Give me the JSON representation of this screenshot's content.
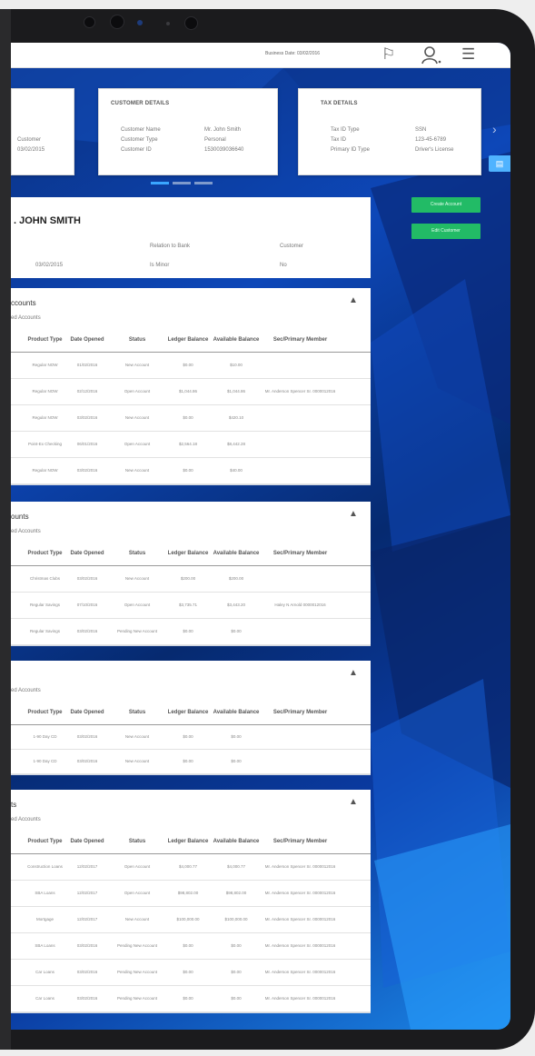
{
  "topbar": {
    "business_date": "Business Date: 03/02/2016",
    "icons": [
      "flag-icon",
      "user-icon",
      "menu-icon"
    ]
  },
  "cards": {
    "partial": {
      "rows": [
        {
          "value": "Customer"
        },
        {
          "value": "03/02/2015"
        }
      ]
    },
    "customer": {
      "title": "CUSTOMER DETAILS",
      "rows": [
        {
          "label": "Customer Name",
          "value": "Mr. John Smith"
        },
        {
          "label": "Customer Type",
          "value": "Personal"
        },
        {
          "label": "Customer ID",
          "value": "1530039036640"
        }
      ]
    },
    "tax": {
      "title": "TAX DETAILS",
      "rows": [
        {
          "label": "Tax ID Type",
          "value": "SSN"
        },
        {
          "label": "Tax ID",
          "value": "123-45-6789"
        },
        {
          "label": "Primary ID Type",
          "value": "Driver's License"
        }
      ]
    }
  },
  "actions": {
    "create_account": "Create Account",
    "edit_customer": "Edit Customer"
  },
  "customer": {
    "name": ". JOHN SMITH",
    "relation_label": "Relation to Bank",
    "relation_value": "Customer",
    "since": "03/02/2015",
    "minor_label": "Is Minor",
    "minor_value": "No"
  },
  "columns": [
    "Product Type",
    "Date Opened",
    "Status",
    "Ledger Balance",
    "Available Balance",
    "Sec/Primary Member"
  ],
  "sections": [
    {
      "title": "ccounts",
      "subtitle": "ed Accounts",
      "rows": [
        [
          "Regular NOW",
          "01/02/2016",
          "New Account",
          "$0.00",
          "$10.00",
          ""
        ],
        [
          "Regular NOW",
          "02/12/2016",
          "Open Account",
          "$1,044.86",
          "$1,044.86",
          "Mr. Anderson Spencer Sr. 0000012016"
        ],
        [
          "Regular NOW",
          "03/02/2016",
          "New Account",
          "$0.00",
          "$420.10",
          ""
        ],
        [
          "Point-Ex Checking",
          "06/01/2016",
          "Open Account",
          "$2,564.18",
          "$8,442.28",
          ""
        ],
        [
          "Regular NOW",
          "03/02/2016",
          "New Account",
          "$0.00",
          "$40.00",
          ""
        ]
      ]
    },
    {
      "title": "ounts",
      "subtitle": "ed Accounts",
      "rows": [
        [
          "Christmas Clubs",
          "03/02/2016",
          "New Account",
          "$200.00",
          "$200.00",
          ""
        ],
        [
          "Regular Savings",
          "07/10/2016",
          "Open Account",
          "$3,735.71",
          "$3,443.20",
          "Haley N Arnold 0000012016"
        ],
        [
          "Regular Savings",
          "03/02/2016",
          "Pending New Account",
          "$0.00",
          "$0.00",
          ""
        ]
      ]
    },
    {
      "title": "",
      "subtitle": "ed Accounts",
      "rows": [
        [
          "1-90 Day CD",
          "03/02/2016",
          "New Account",
          "$0.00",
          "$0.00",
          ""
        ],
        [
          "1-90 Day CD",
          "03/02/2016",
          "New Account",
          "$0.00",
          "$0.00",
          ""
        ]
      ]
    },
    {
      "title": "ts",
      "subtitle": "ed Accounts",
      "rows": [
        [
          "Construction Loans",
          "12/02/2017",
          "Open Account",
          "$4,000.77",
          "$4,000.77",
          "Mr. Anderson Spencer Sr. 0000012016"
        ],
        [
          "SBA Loans",
          "12/02/2017",
          "Open Account",
          "$98,802.00",
          "$98,802.00",
          "Mr. Anderson Spencer Sr. 0000012016"
        ],
        [
          "Mortgage",
          "12/02/2017",
          "New Account",
          "$100,000.00",
          "$100,000.00",
          "Mr. Anderson Spencer Sr. 0000012016"
        ],
        [
          "SBA Loans",
          "03/02/2016",
          "Pending New Account",
          "$0.00",
          "$0.00",
          "Mr. Anderson Spencer Sr. 0000012016"
        ],
        [
          "Car Loans",
          "03/02/2016",
          "Pending New Account",
          "$0.00",
          "$0.00",
          "Mr. Anderson Spencer Sr. 0000012016"
        ],
        [
          "Car Loans",
          "03/02/2016",
          "Pending New Account",
          "$0.00",
          "$0.00",
          "Mr. Anderson Spencer Sr. 0000012016"
        ]
      ]
    }
  ]
}
